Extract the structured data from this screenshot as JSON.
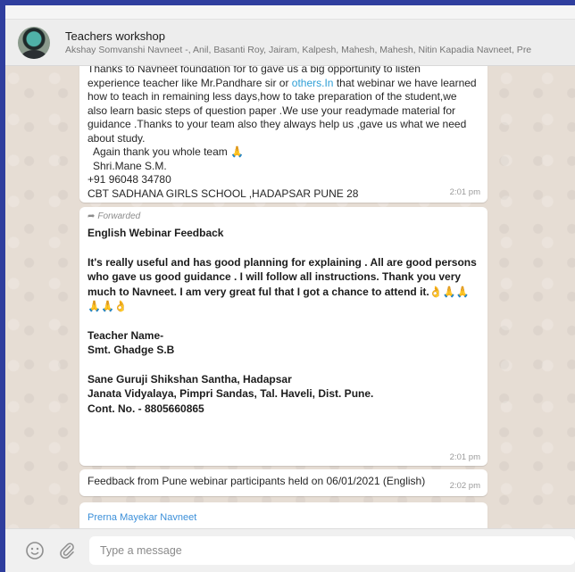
{
  "header": {
    "title": "Teachers workshop",
    "members": "Akshay Somvanshi Navneet -, Anil, Basanti Roy, Jairam, Kalpesh, Mahesh, Mahesh, Nitin Kapadia Navneet, Pre"
  },
  "messages": {
    "m1": {
      "lines": [
        "Thanks to Navneet foundation for to gave us a big opportunity to listen",
        "how to teach in remaining less days,how to take preparation of the student,we",
        "also learn basic steps of question paper .We use your readymade material for",
        "guidance .Thanks to your team also they always help us ,gave us what we need",
        "about study.",
        "Again thank you whole team 🙏",
        "Shri.Mane S.M.",
        "+91 96048 34780",
        "CBT SADHANA GIRLS SCHOOL ,HADAPSAR PUNE 28"
      ],
      "line2_pre": "experience teacher like Mr.Pandhare sir or ",
      "line2_link": "others.In",
      "line2_post": " that webinar we have learned",
      "time": "2:01 pm"
    },
    "m2": {
      "forwarded": "Forwarded",
      "title": "English Webinar Feedback",
      "para1": "It's really useful and has good planning for explaining . All are good persons who gave us good guidance . I will follow all instructions. Thank you very much to Navneet. I am very great ful that I  got a chance to attend it.👌🙏🙏🙏🙏👌",
      "teacher1": "Teacher Name-",
      "teacher2": "Smt. Ghadge S.B",
      "school1": "Sane Guruji Shikshan Santha, Hadapsar",
      "school2": "Janata Vidyalaya, Pimpri Sandas, Tal. Haveli, Dist. Pune.",
      "school3": "Cont. No. - 8805660865",
      "time": "2:01 pm"
    },
    "m3": {
      "text": "Feedback from Pune webinar participants held on 06/01/2021 (English)",
      "time": "2:02 pm"
    },
    "m4": {
      "sender": "Prerna Mayekar Navneet"
    }
  },
  "composer": {
    "placeholder": "Type a message",
    "emoji_icon": "smiley-icon",
    "attach_icon": "paperclip-icon"
  }
}
